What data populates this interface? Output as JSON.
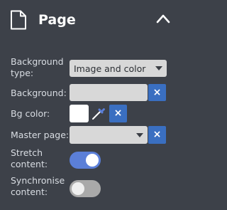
{
  "header": {
    "title": "Page",
    "page_icon": "page-icon",
    "collapse_icon": "chevron-up-icon"
  },
  "fields": {
    "background_type": {
      "label_line1": "Background",
      "label_line2": "type:",
      "value": "Image and color"
    },
    "background": {
      "label": "Background:",
      "value": "",
      "clear_label": "×"
    },
    "bg_color": {
      "label": "Bg color:",
      "value": "#ffffff",
      "picker_icon": "eyedropper-icon",
      "clear_label": "×"
    },
    "master_page": {
      "label": "Master page:",
      "value": "",
      "clear_label": "×"
    },
    "stretch_content": {
      "label_line1": "Stretch",
      "label_line2": "content:",
      "enabled": true
    },
    "synchronise_content": {
      "label_line1": "Synchronise",
      "label_line2": "content:",
      "enabled": false
    }
  },
  "colors": {
    "panel_bg": "#3d4149",
    "accent": "#3a6fc1",
    "toggle_on": "#5b7fd8",
    "toggle_off": "#a9a9a9"
  }
}
